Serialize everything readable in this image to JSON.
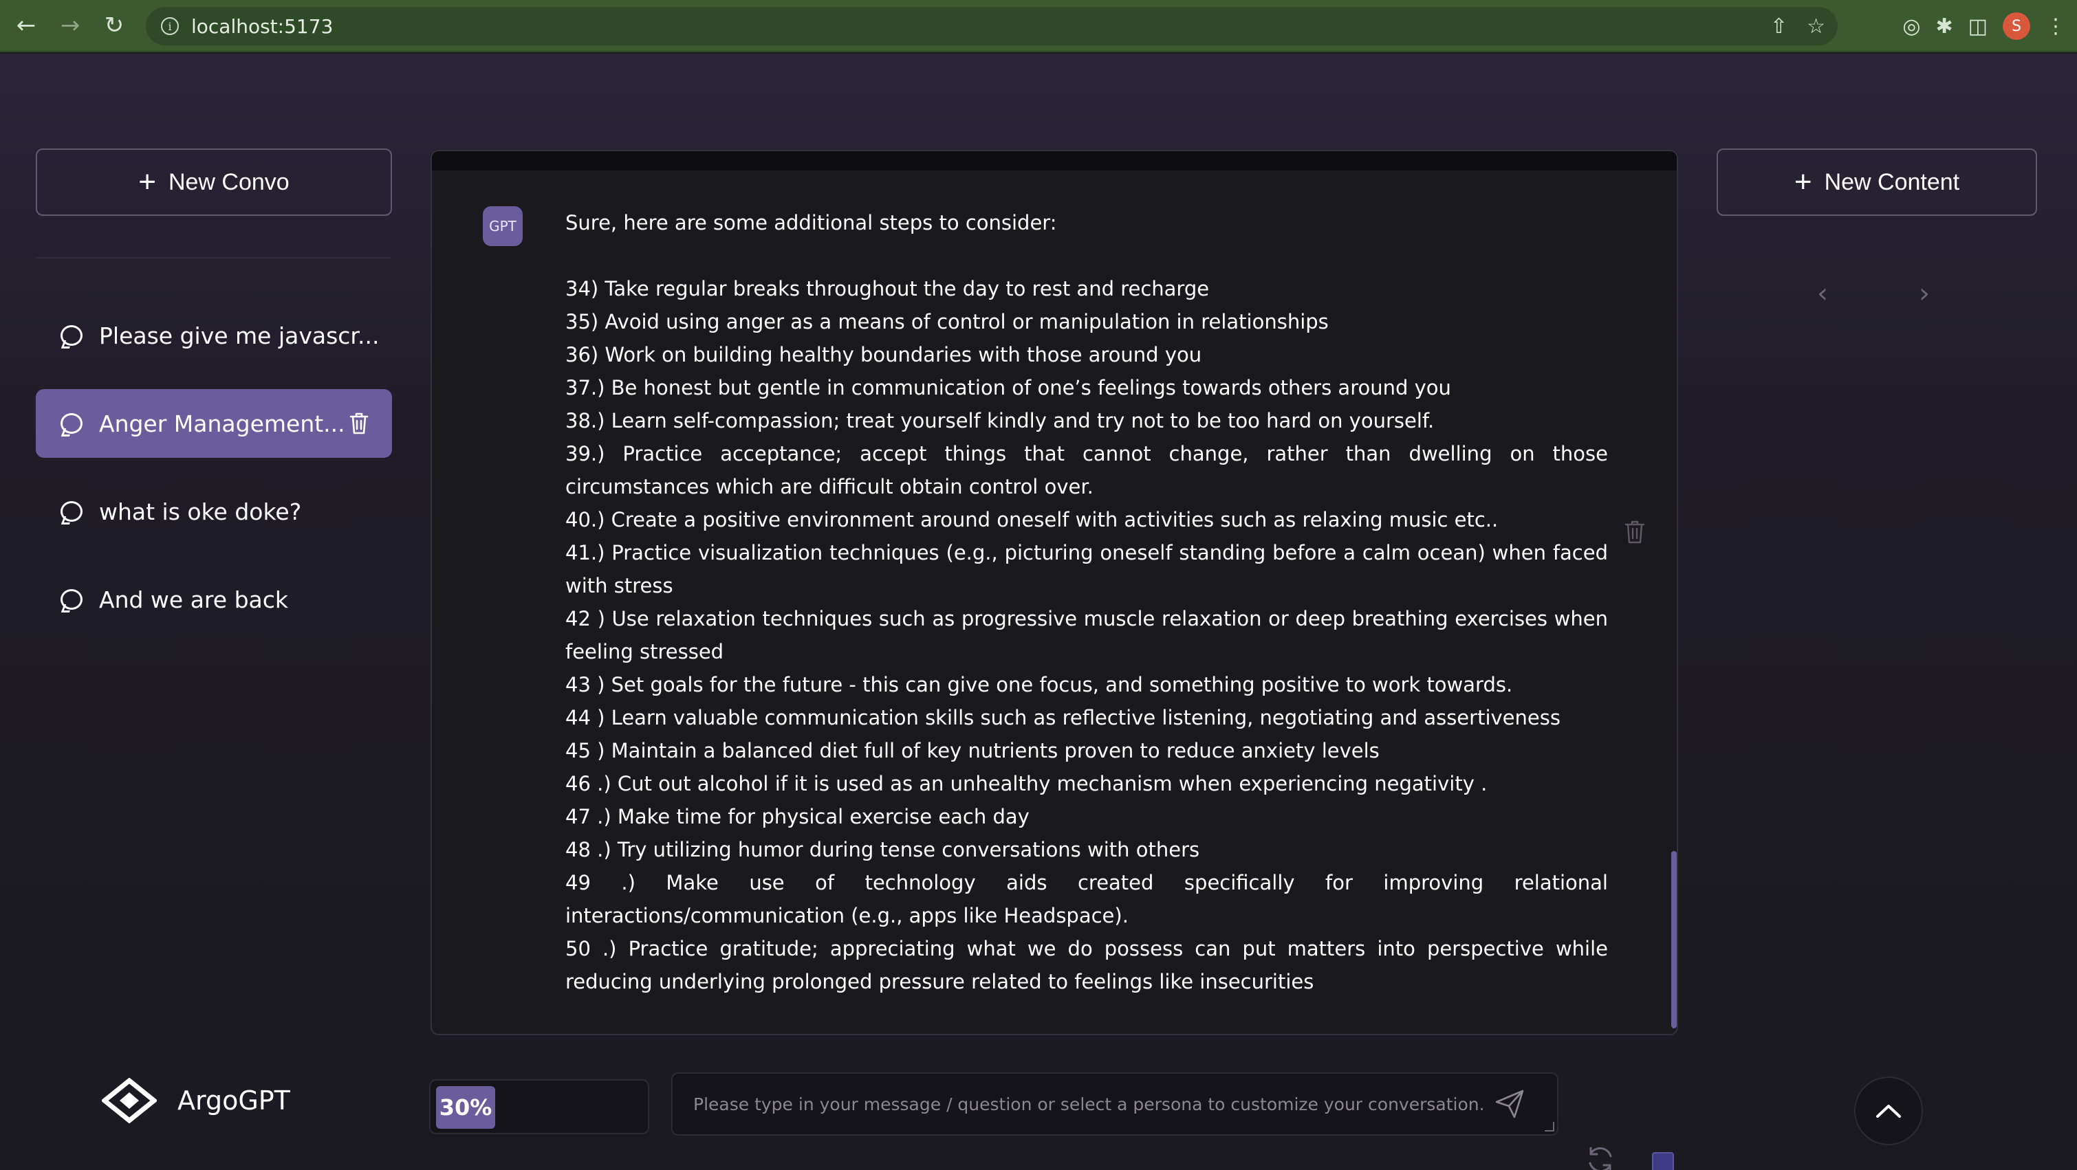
{
  "browser": {
    "url": "localhost:5173"
  },
  "sidebar": {
    "new_convo_label": "New Convo",
    "conversations": [
      {
        "title": "Please give me javascr..."
      },
      {
        "title": "Anger Management..."
      },
      {
        "title": "what is oke doke?"
      },
      {
        "title": "And we are back"
      }
    ],
    "active_index": 1,
    "logo_text": "ArgoGPT"
  },
  "right_panel": {
    "new_content_label": "New Content"
  },
  "chat": {
    "avatar_label": "GPT",
    "intro": "Sure, here are some additional steps to consider:",
    "items": [
      "34) Take regular breaks throughout the day to rest and recharge",
      "35) Avoid using anger as a means of control or manipulation in relationships",
      "36) Work on building healthy boundaries with those around you",
      "37.) Be honest but gentle in communication of one’s feelings towards others around you",
      "38.) Learn self-compassion; treat yourself kindly and try not to be too hard on yourself.",
      "39.) Practice acceptance; accept things that cannot change, rather than dwelling on those circumstances which are difficult obtain control over.",
      "40.) Create a positive environment around oneself with activities such as relaxing music etc..",
      "41.) Practice visualization techniques (e.g., picturing oneself standing before a calm ocean) when faced with stress",
      "42 ) Use relaxation techniques such as progressive muscle relaxation or deep breathing exercises when feeling stressed",
      "43 ) Set goals for the future - this can give one focus, and something positive to work towards.",
      "44 ) Learn valuable communication skills such as reflective listening, negotiating and assertiveness",
      "45 ) Maintain a balanced diet full of key nutrients proven to reduce anxiety levels",
      "46 .) Cut out alcohol if it is used as an unhealthy mechanism when experiencing negativity   .",
      "47 .) Make time for physical exercise each day",
      "48 .) Try utilizing humor during tense conversations with others",
      "49 .) Make use of technology aids created specifically for improving relational interactions/communication (e.g., apps like Headspace).",
      "50 .) Practice gratitude; appreciating what we do possess can put matters into perspective while reducing underlying prolonged pressure related to feelings like insecurities"
    ]
  },
  "composer": {
    "percent": "30%",
    "placeholder": "Please type in your message / question or select a persona to customize your conversation."
  },
  "colors": {
    "accent": "#6b5d9c",
    "background": "#1e1b24",
    "browser_bar": "#3c5a30"
  }
}
